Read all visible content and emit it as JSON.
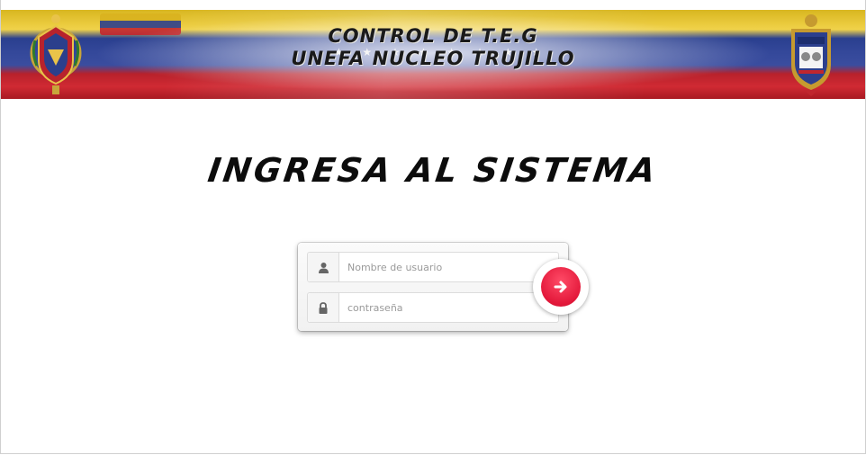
{
  "banner": {
    "title_line1": "CONTROL DE T.E.G",
    "title_line2": "UNEFA NUCLEO TRUJILLO",
    "left_emblem": "coat-of-arms",
    "right_emblem": "unefa-shield"
  },
  "heading": "INGRESA AL SISTEMA",
  "login": {
    "username_placeholder": "Nombre de usuario",
    "username_value": "",
    "password_placeholder": "contraseña",
    "password_value": "",
    "username_icon": "user-icon",
    "password_icon": "lock-icon",
    "submit_icon": "arrow-right-icon"
  },
  "colors": {
    "flag_yellow": "#e8c83a",
    "flag_blue": "#34489a",
    "flag_red": "#d02a33",
    "submit_red": "#e3183a",
    "heading_text": "#0c0c0c"
  }
}
